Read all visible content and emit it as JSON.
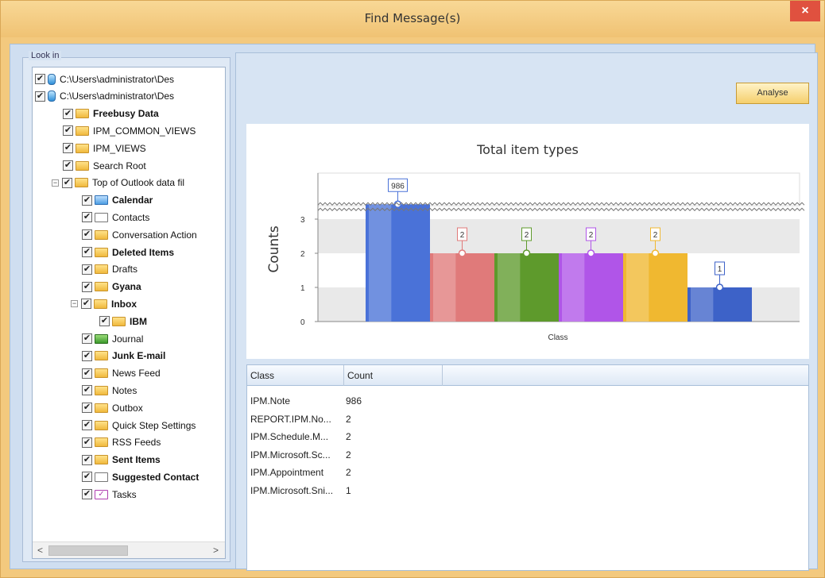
{
  "window": {
    "title": "Find Message(s)",
    "close_glyph": "×"
  },
  "look_in": {
    "legend": "Look in",
    "tree": [
      {
        "label": "C:\\Users\\administrator\\Des",
        "icon": "drive-icon",
        "expander": "+",
        "bold": false
      },
      {
        "label": "C:\\Users\\administrator\\Des",
        "icon": "drive-icon",
        "expander": "−",
        "bold": false
      },
      {
        "label": "Freebusy Data",
        "icon": "folder-icon",
        "bold": true
      },
      {
        "label": "IPM_COMMON_VIEWS",
        "icon": "folder-icon",
        "bold": false
      },
      {
        "label": "IPM_VIEWS",
        "icon": "folder-icon",
        "bold": false
      },
      {
        "label": "Search Root",
        "icon": "folder-icon",
        "bold": false
      },
      {
        "label": "Top of Outlook data fil",
        "icon": "folder-icon",
        "expander": "−",
        "bold": false
      },
      {
        "label": "Calendar",
        "icon": "calendar-icon",
        "bold": true
      },
      {
        "label": "Contacts",
        "icon": "contacts-icon",
        "bold": false
      },
      {
        "label": "Conversation Action",
        "icon": "folder-icon",
        "bold": false
      },
      {
        "label": "Deleted Items",
        "icon": "folder-icon",
        "bold": true
      },
      {
        "label": "Drafts",
        "icon": "folder-icon",
        "bold": false
      },
      {
        "label": "Gyana",
        "icon": "folder-icon",
        "bold": true
      },
      {
        "label": "Inbox",
        "icon": "folder-icon",
        "expander": "−",
        "bold": true
      },
      {
        "label": "IBM",
        "icon": "folder-icon",
        "bold": true
      },
      {
        "label": "Journal",
        "icon": "journal-icon",
        "bold": false
      },
      {
        "label": "Junk E-mail",
        "icon": "folder-icon",
        "bold": true
      },
      {
        "label": "News Feed",
        "icon": "folder-icon",
        "bold": false
      },
      {
        "label": "Notes",
        "icon": "folder-icon",
        "bold": false
      },
      {
        "label": "Outbox",
        "icon": "folder-icon",
        "bold": false
      },
      {
        "label": "Quick Step Settings",
        "icon": "folder-icon",
        "bold": false
      },
      {
        "label": "RSS Feeds",
        "icon": "folder-icon",
        "bold": false
      },
      {
        "label": "Sent Items",
        "icon": "folder-icon",
        "bold": true
      },
      {
        "label": "Suggested Contact",
        "icon": "contacts-icon",
        "bold": true
      },
      {
        "label": "Tasks",
        "icon": "tasks-icon",
        "bold": false
      }
    ],
    "scroll_left": "<",
    "scroll_right": ">"
  },
  "analyse_label": "Analyse",
  "chart_data": {
    "type": "bar",
    "title": "Total item types",
    "xlabel": "Class",
    "ylabel": "Counts",
    "yticks": [
      "0",
      "1",
      "2",
      "3"
    ],
    "axis_break": true,
    "categories": [
      "IPM.Note",
      "REPORT.IPM.No...",
      "IPM.Schedule.M...",
      "IPM.Microsoft.Sc...",
      "IPM.Appointment",
      "IPM.Microsoft.Sni..."
    ],
    "values": [
      986,
      2,
      2,
      2,
      2,
      1
    ],
    "labels": [
      "986",
      "2",
      "2",
      "2",
      "2",
      "1"
    ],
    "colors": [
      "#4a72d8",
      "#e07a7a",
      "#5e9a2c",
      "#b055e8",
      "#f0b830",
      "#3d62c8"
    ]
  },
  "table": {
    "headers": [
      "Class",
      "Count"
    ],
    "rows": [
      [
        "IPM.Note",
        "986"
      ],
      [
        "REPORT.IPM.No...",
        "2"
      ],
      [
        "IPM.Schedule.M...",
        "2"
      ],
      [
        "IPM.Microsoft.Sc...",
        "2"
      ],
      [
        "IPM.Appointment",
        "2"
      ],
      [
        "IPM.Microsoft.Sni...",
        "1"
      ]
    ]
  }
}
